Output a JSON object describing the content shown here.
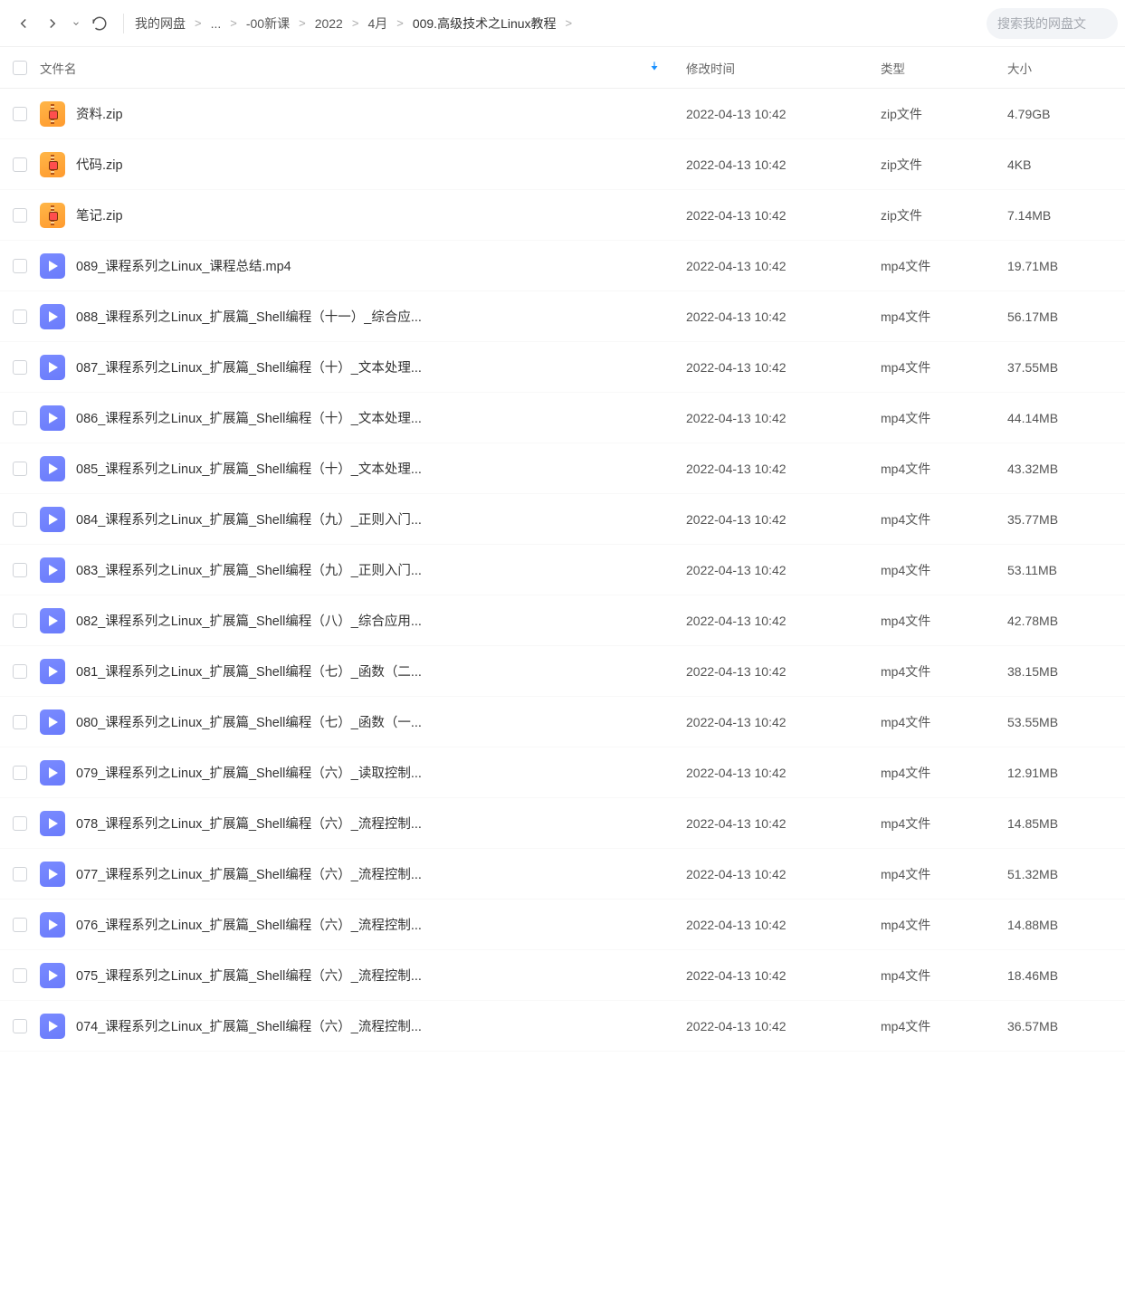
{
  "toolbar": {
    "breadcrumbs": [
      {
        "label": "我的网盘"
      },
      {
        "label": "..."
      },
      {
        "label": "-00新课"
      },
      {
        "label": "2022"
      },
      {
        "label": "4月"
      },
      {
        "label": "009.高级技术之Linux教程"
      }
    ],
    "search_placeholder": "搜索我的网盘文"
  },
  "columns": {
    "name": "文件名",
    "mtime": "修改时间",
    "type": "类型",
    "size": "大小"
  },
  "files": [
    {
      "icon": "zip",
      "name": "资料.zip",
      "mtime": "2022-04-13 10:42",
      "type": "zip文件",
      "size": "4.79GB"
    },
    {
      "icon": "zip",
      "name": "代码.zip",
      "mtime": "2022-04-13 10:42",
      "type": "zip文件",
      "size": "4KB"
    },
    {
      "icon": "zip",
      "name": "笔记.zip",
      "mtime": "2022-04-13 10:42",
      "type": "zip文件",
      "size": "7.14MB"
    },
    {
      "icon": "mp4",
      "name": "089_课程系列之Linux_课程总结.mp4",
      "mtime": "2022-04-13 10:42",
      "type": "mp4文件",
      "size": "19.71MB"
    },
    {
      "icon": "mp4",
      "name": "088_课程系列之Linux_扩展篇_Shell编程（十一）_综合应...",
      "mtime": "2022-04-13 10:42",
      "type": "mp4文件",
      "size": "56.17MB"
    },
    {
      "icon": "mp4",
      "name": "087_课程系列之Linux_扩展篇_Shell编程（十）_文本处理...",
      "mtime": "2022-04-13 10:42",
      "type": "mp4文件",
      "size": "37.55MB"
    },
    {
      "icon": "mp4",
      "name": "086_课程系列之Linux_扩展篇_Shell编程（十）_文本处理...",
      "mtime": "2022-04-13 10:42",
      "type": "mp4文件",
      "size": "44.14MB"
    },
    {
      "icon": "mp4",
      "name": "085_课程系列之Linux_扩展篇_Shell编程（十）_文本处理...",
      "mtime": "2022-04-13 10:42",
      "type": "mp4文件",
      "size": "43.32MB"
    },
    {
      "icon": "mp4",
      "name": "084_课程系列之Linux_扩展篇_Shell编程（九）_正则入门...",
      "mtime": "2022-04-13 10:42",
      "type": "mp4文件",
      "size": "35.77MB"
    },
    {
      "icon": "mp4",
      "name": "083_课程系列之Linux_扩展篇_Shell编程（九）_正则入门...",
      "mtime": "2022-04-13 10:42",
      "type": "mp4文件",
      "size": "53.11MB"
    },
    {
      "icon": "mp4",
      "name": "082_课程系列之Linux_扩展篇_Shell编程（八）_综合应用...",
      "mtime": "2022-04-13 10:42",
      "type": "mp4文件",
      "size": "42.78MB"
    },
    {
      "icon": "mp4",
      "name": "081_课程系列之Linux_扩展篇_Shell编程（七）_函数（二...",
      "mtime": "2022-04-13 10:42",
      "type": "mp4文件",
      "size": "38.15MB"
    },
    {
      "icon": "mp4",
      "name": "080_课程系列之Linux_扩展篇_Shell编程（七）_函数（一...",
      "mtime": "2022-04-13 10:42",
      "type": "mp4文件",
      "size": "53.55MB"
    },
    {
      "icon": "mp4",
      "name": "079_课程系列之Linux_扩展篇_Shell编程（六）_读取控制...",
      "mtime": "2022-04-13 10:42",
      "type": "mp4文件",
      "size": "12.91MB"
    },
    {
      "icon": "mp4",
      "name": "078_课程系列之Linux_扩展篇_Shell编程（六）_流程控制...",
      "mtime": "2022-04-13 10:42",
      "type": "mp4文件",
      "size": "14.85MB"
    },
    {
      "icon": "mp4",
      "name": "077_课程系列之Linux_扩展篇_Shell编程（六）_流程控制...",
      "mtime": "2022-04-13 10:42",
      "type": "mp4文件",
      "size": "51.32MB"
    },
    {
      "icon": "mp4",
      "name": "076_课程系列之Linux_扩展篇_Shell编程（六）_流程控制...",
      "mtime": "2022-04-13 10:42",
      "type": "mp4文件",
      "size": "14.88MB"
    },
    {
      "icon": "mp4",
      "name": "075_课程系列之Linux_扩展篇_Shell编程（六）_流程控制...",
      "mtime": "2022-04-13 10:42",
      "type": "mp4文件",
      "size": "18.46MB"
    },
    {
      "icon": "mp4",
      "name": "074_课程系列之Linux_扩展篇_Shell编程（六）_流程控制...",
      "mtime": "2022-04-13 10:42",
      "type": "mp4文件",
      "size": "36.57MB"
    }
  ]
}
